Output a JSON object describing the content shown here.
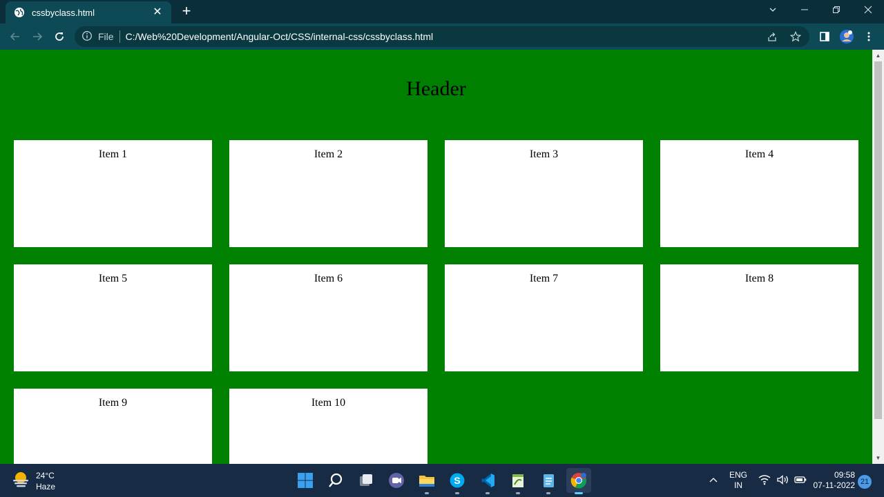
{
  "browser": {
    "tab_title": "cssbyclass.html",
    "new_tab_label": "+",
    "omnibox_scheme": "File",
    "url": "C:/Web%20Development/Angular-Oct/CSS/internal-css/cssbyclass.html"
  },
  "page": {
    "header": "Header",
    "items": [
      "Item 1",
      "Item 2",
      "Item 3",
      "Item 4",
      "Item 5",
      "Item 6",
      "Item 7",
      "Item 8",
      "Item 9",
      "Item 10"
    ],
    "background_color": "#008000",
    "card_color": "#ffffff"
  },
  "taskbar": {
    "weather_temp": "24°C",
    "weather_desc": "Haze",
    "lang_top": "ENG",
    "lang_bottom": "IN",
    "time": "09:58",
    "date": "07-11-2022",
    "notifications": "21",
    "apps": [
      "start-icon",
      "search-icon",
      "task-view-icon",
      "teams-chat-icon",
      "file-explorer-icon",
      "skype-icon",
      "vscode-icon",
      "notepad-plus-icon",
      "notepad-icon",
      "chrome-icon"
    ]
  }
}
